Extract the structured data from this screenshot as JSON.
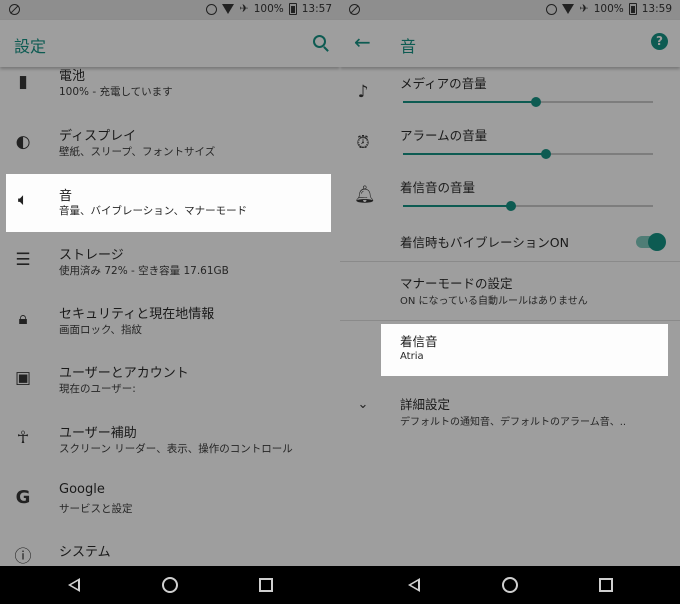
{
  "status_left": {
    "battery_pct": "100%",
    "time": "13:57"
  },
  "status_right": {
    "battery_pct": "100%",
    "time": "13:59"
  },
  "settings": {
    "title": "設定",
    "items": [
      {
        "title": "電池",
        "subtitle": "100% - 充電しています",
        "icon": "battery-icon"
      },
      {
        "title": "ディスプレイ",
        "subtitle": "壁紙、スリープ、フォントサイズ",
        "icon": "brightness-icon"
      },
      {
        "title": "音",
        "subtitle": "音量、バイブレーション、マナーモード",
        "icon": "volume-icon"
      },
      {
        "title": "ストレージ",
        "subtitle": "使用済み 72% - 空き容量 17.61GB",
        "icon": "storage-icon"
      },
      {
        "title": "セキュリティと現在地情報",
        "subtitle": "画面ロック、指紋",
        "icon": "lock-icon"
      },
      {
        "title": "ユーザーとアカウント",
        "subtitle": "現在のユーザー:",
        "icon": "account-icon"
      },
      {
        "title": "ユーザー補助",
        "subtitle": "スクリーン リーダー、表示、操作のコントロール",
        "icon": "accessibility-icon"
      },
      {
        "title": "Google",
        "subtitle": "サービスと設定",
        "icon": "google-icon"
      },
      {
        "title": "システム",
        "subtitle": "",
        "icon": "info-icon"
      }
    ]
  },
  "sound": {
    "title": "音",
    "media_volume": {
      "label": "メディアの音量",
      "level": 0.53
    },
    "alarm_volume": {
      "label": "アラームの音量",
      "level": 0.57
    },
    "ring_volume": {
      "label": "着信音の音量",
      "level": 0.43
    },
    "vibrate": {
      "label": "着信時もバイブレーションON",
      "on": true
    },
    "dnd": {
      "title": "マナーモードの設定",
      "subtitle": "ON になっている自動ルールはありません"
    },
    "ringtone": {
      "title": "着信音",
      "subtitle": "Atria"
    },
    "advanced": {
      "title": "詳細設定",
      "subtitle": "デフォルトの通知音、デフォルトのアラーム音、.."
    }
  },
  "colors": {
    "accent": "#0d5b52",
    "background": "#9e9e9e",
    "highlight": "#fdfdfd"
  }
}
